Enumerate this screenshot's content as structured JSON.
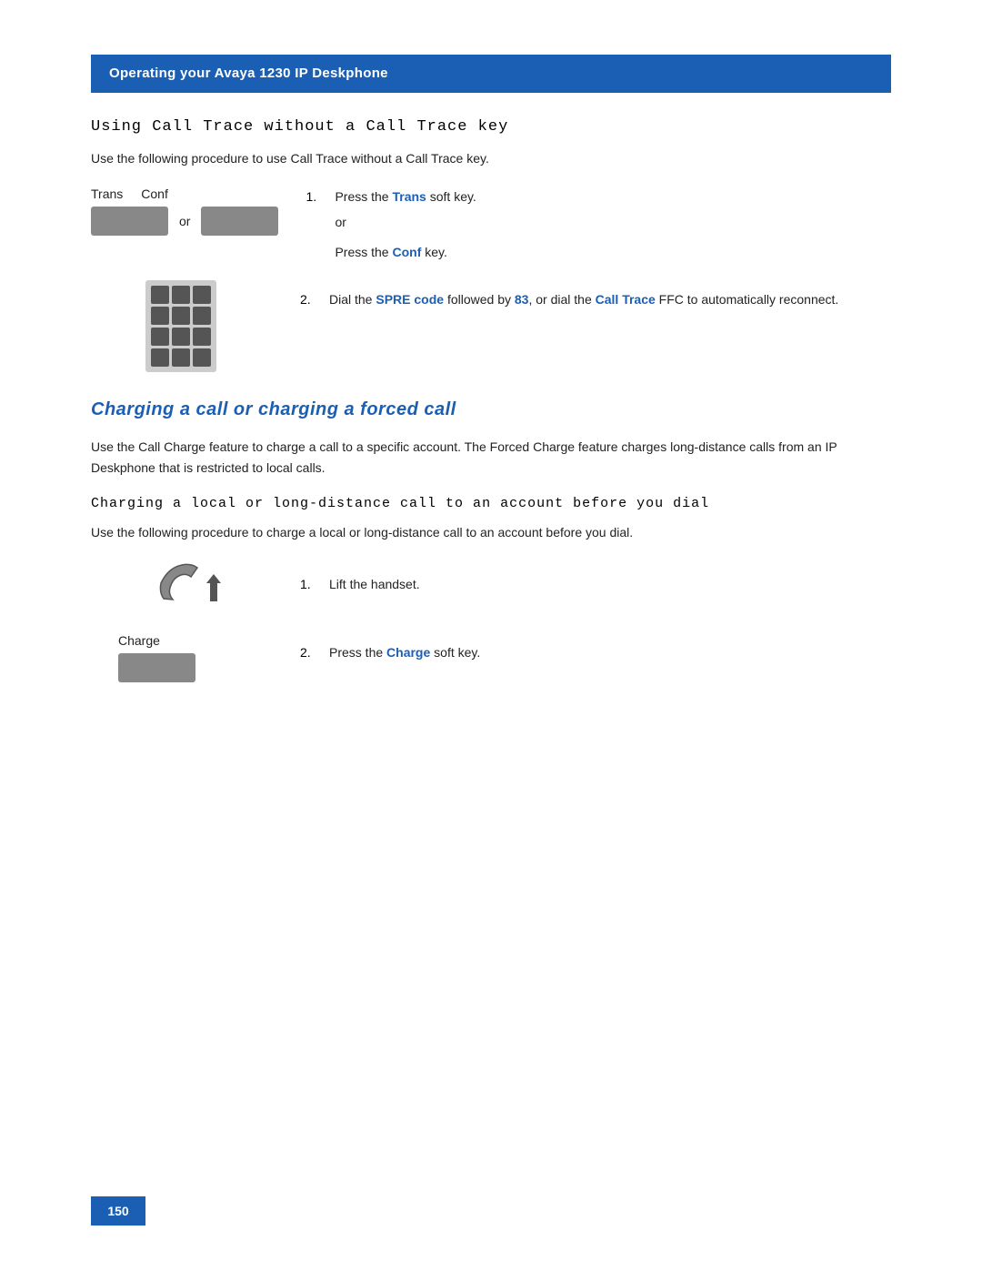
{
  "header": {
    "background_color": "#1a5fb4",
    "text": "Operating your Avaya 1230 IP Deskphone"
  },
  "section1": {
    "title": "Using Call Trace without a Call Trace key",
    "body": "Use the following procedure to use Call Trace without a Call Trace key.",
    "trans_label": "Trans",
    "conf_label": "Conf",
    "or_text": "or",
    "step1": {
      "num": "1.",
      "text_before": "Press the ",
      "link_text": "Trans",
      "text_after": " soft key."
    },
    "or_line": "or",
    "step1b": {
      "text_before": "Press the ",
      "link_text": "Conf",
      "text_after": " key."
    },
    "step2": {
      "num": "2.",
      "text_before": "Dial the ",
      "link1": "SPRE code",
      "text_mid1": " followed by ",
      "link2": "83",
      "text_mid2": ", or dial the ",
      "link3": "Call Trace",
      "text_after": " FFC to automatically reconnect."
    }
  },
  "section2": {
    "heading": "Charging a call or charging a forced call",
    "body": "Use the Call Charge feature to charge a call to a specific account. The Forced Charge feature charges long-distance calls from an IP Deskphone that is restricted to local calls.",
    "subsection_title": "Charging a local or long-distance call to an account before you dial",
    "subsection_body": "Use the following procedure to charge a local or long-distance call to an account before you dial.",
    "charge_label": "Charge",
    "step1": {
      "num": "1.",
      "text": "Lift the handset."
    },
    "step2": {
      "num": "2.",
      "text_before": "Press the ",
      "link_text": "Charge",
      "text_after": " soft key."
    }
  },
  "page_number": "150",
  "colors": {
    "blue": "#1a5fb4",
    "header_bg": "#1a5fb4"
  }
}
